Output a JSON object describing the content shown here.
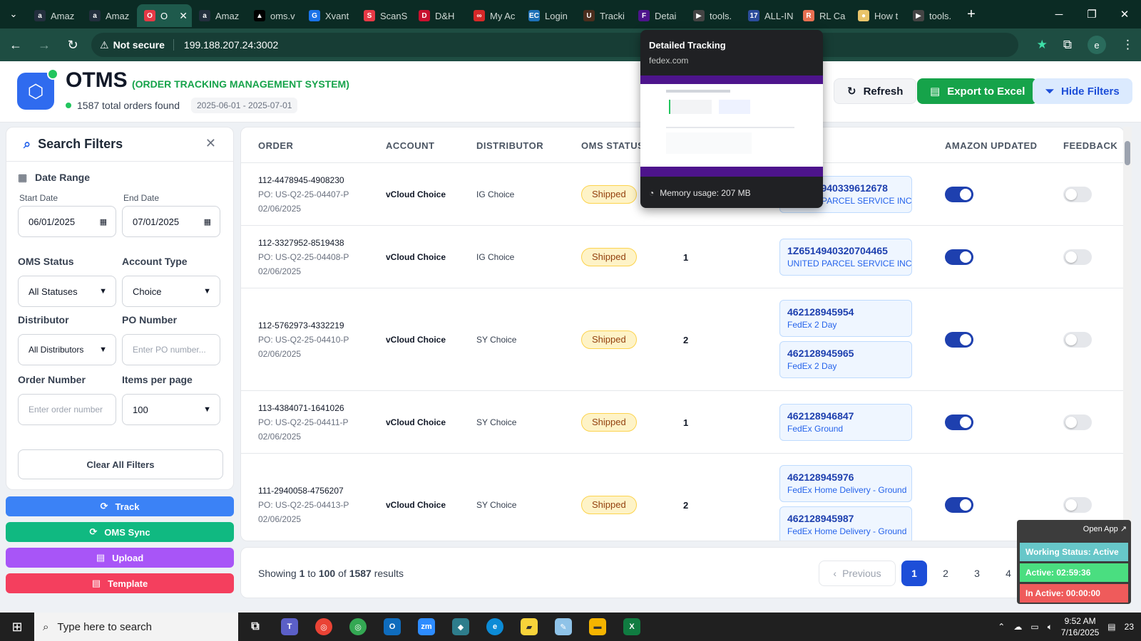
{
  "browser": {
    "tabs": [
      {
        "label": "Amaz",
        "icon_text": "a",
        "color": "#232f3e"
      },
      {
        "label": "Amaz",
        "icon_text": "a",
        "color": "#232f3e"
      },
      {
        "label": "O",
        "icon_text": "O",
        "color": "#e63946",
        "active": true
      },
      {
        "label": "Amaz",
        "icon_text": "a",
        "color": "#232f3e"
      },
      {
        "label": "oms.v",
        "icon_text": "▲",
        "color": "#000000"
      },
      {
        "label": "Xvant",
        "icon_text": "G",
        "color": "#1a73e8"
      },
      {
        "label": "ScanS",
        "icon_text": "S",
        "color": "#e63946"
      },
      {
        "label": "D&H",
        "icon_text": "D",
        "color": "#c8102e"
      },
      {
        "label": "My Ac",
        "icon_text": "∞",
        "color": "#d62828"
      },
      {
        "label": "Login",
        "icon_text": "EC",
        "color": "#1d70b8"
      },
      {
        "label": "Tracki",
        "icon_text": "U",
        "color": "#4b2e1e"
      },
      {
        "label": "Detai",
        "icon_text": "F",
        "color": "#4d148c"
      },
      {
        "label": "tools.",
        "icon_text": "▶",
        "color": "#444444"
      },
      {
        "label": "ALL-IN",
        "icon_text": "17",
        "color": "#2b4c9b"
      },
      {
        "label": "RL Ca",
        "icon_text": "R",
        "color": "#e76f51"
      },
      {
        "label": "How t",
        "icon_text": "●",
        "color": "#e9c46a"
      },
      {
        "label": "tools.",
        "icon_text": "▶",
        "color": "#444444"
      }
    ],
    "security_label": "Not secure",
    "url": "199.188.207.24:3002",
    "profile_initial": "e"
  },
  "app": {
    "title": "OTMS",
    "subtitle": "(ORDER TRACKING MANAGEMENT SYSTEM)",
    "orders_found": "1587 total orders found",
    "date_range": "2025-06-01 - 2025-07-01",
    "refresh_label": "Refresh",
    "export_label": "Export to Excel",
    "hide_filters_label": "Hide Filters"
  },
  "filters": {
    "title": "Search Filters",
    "date_range_label": "Date Range",
    "start_date_label": "Start Date",
    "start_date": "06/01/2025",
    "end_date_label": "End Date",
    "end_date": "07/01/2025",
    "oms_status_label": "OMS Status",
    "oms_status_value": "All Statuses",
    "account_type_label": "Account Type",
    "account_type_value": "Choice",
    "distributor_label": "Distributor",
    "distributor_value": "All Distributors",
    "po_number_label": "PO Number",
    "po_number_placeholder": "Enter PO number...",
    "order_number_label": "Order Number",
    "order_number_placeholder": "Enter order number",
    "items_per_page_label": "Items per page",
    "items_per_page_value": "100",
    "clear_label": "Clear All Filters"
  },
  "actions": {
    "track": "Track",
    "oms_sync": "OMS Sync",
    "upload": "Upload",
    "template": "Template"
  },
  "table": {
    "headers": {
      "order": "ORDER",
      "account": "ACCOUNT",
      "distributor": "DISTRIBUTOR",
      "oms_status": "OMS STATUS",
      "amazon_updated": "AMAZON UPDATED",
      "feedback": "FEEDBACK"
    },
    "rows": [
      {
        "order": "112-4478945-4908230",
        "po": "PO: US-Q2-25-04407-P",
        "date": "02/06/2025",
        "account": "vCloud Choice",
        "distributor": "IG Choice",
        "status": "Shipped",
        "qty": "",
        "tracking": [
          {
            "num": "1Z6514940339612678",
            "carrier": "UNITED PARCEL SERVICE INC"
          }
        ]
      },
      {
        "order": "112-3327952-8519438",
        "po": "PO: US-Q2-25-04408-P",
        "date": "02/06/2025",
        "account": "vCloud Choice",
        "distributor": "IG Choice",
        "status": "Shipped",
        "qty": "1",
        "tracking": [
          {
            "num": "1Z6514940320704465",
            "carrier": "UNITED PARCEL SERVICE INC"
          }
        ]
      },
      {
        "order": "112-5762973-4332219",
        "po": "PO: US-Q2-25-04410-P",
        "date": "02/06/2025",
        "account": "vCloud Choice",
        "distributor": "SY Choice",
        "status": "Shipped",
        "qty": "2",
        "tracking": [
          {
            "num": "462128945954",
            "carrier": "FedEx 2 Day"
          },
          {
            "num": "462128945965",
            "carrier": "FedEx 2 Day"
          }
        ]
      },
      {
        "order": "113-4384071-1641026",
        "po": "PO: US-Q2-25-04411-P",
        "date": "02/06/2025",
        "account": "vCloud Choice",
        "distributor": "SY Choice",
        "status": "Shipped",
        "qty": "1",
        "tracking": [
          {
            "num": "462128946847",
            "carrier": "FedEx Ground"
          }
        ]
      },
      {
        "order": "111-2940058-4756207",
        "po": "PO: US-Q2-25-04413-P",
        "date": "02/06/2025",
        "account": "vCloud Choice",
        "distributor": "SY Choice",
        "status": "Shipped",
        "qty": "2",
        "tracking": [
          {
            "num": "462128945976",
            "carrier": "FedEx Home Delivery - Ground"
          },
          {
            "num": "462128945987",
            "carrier": "FedEx Home Delivery - Ground"
          }
        ]
      }
    ]
  },
  "pagination": {
    "showing_prefix": "Showing",
    "from": "1",
    "to_word": "to",
    "to": "100",
    "of_word": "of",
    "total": "1587",
    "results_word": "results",
    "previous": "Previous",
    "pages": [
      "1",
      "2",
      "3",
      "4"
    ]
  },
  "tooltip": {
    "title": "Detailed Tracking",
    "url": "fedex.com",
    "memory": "Memory usage: 207 MB"
  },
  "widget": {
    "open_app": "Open App ↗",
    "working": "Working Status: Active",
    "active": "Active: 02:59:36",
    "inactive": "In Active: 00:00:00"
  },
  "taskbar": {
    "search_placeholder": "Type here to search",
    "time": "9:52 AM",
    "date": "7/16/2025",
    "notification_count": "23"
  },
  "colors": {
    "track": "#3b82f6",
    "oms_sync": "#10b981",
    "upload": "#a855f7",
    "template": "#f43f5e"
  }
}
